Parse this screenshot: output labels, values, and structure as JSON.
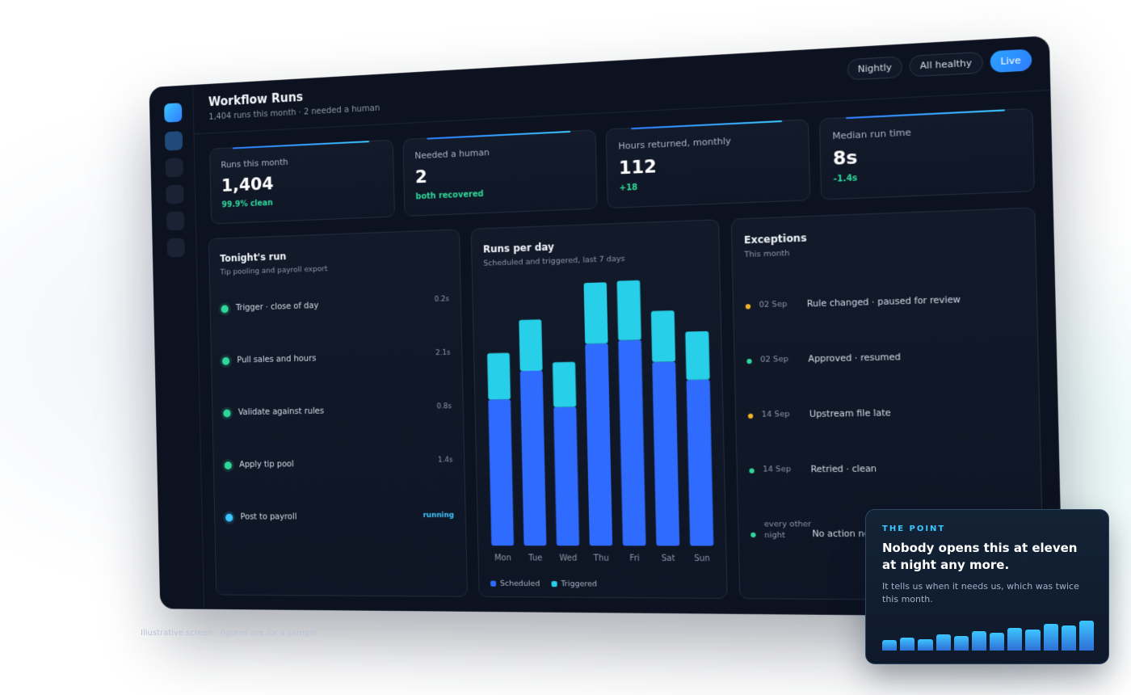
{
  "colors": {
    "scheduled": "#2f6bff",
    "triggered": "#27d0e8",
    "ok": "#2fd89a",
    "warn": "#f5b325",
    "running": "#3cc6ff"
  },
  "header": {
    "title": "Workflow Runs",
    "subtitle": "1,404 runs this month · 2 needed a human",
    "pills": [
      "Nightly",
      "All healthy",
      "Live"
    ]
  },
  "kpis": [
    {
      "label": "Runs this month",
      "value": "1,404",
      "delta": "99.9% clean"
    },
    {
      "label": "Needed a human",
      "value": "2",
      "delta": "both recovered"
    },
    {
      "label": "Hours returned, monthly",
      "value": "112",
      "delta": "+18"
    },
    {
      "label": "Median run time",
      "value": "8s",
      "delta": "-1.4s"
    }
  ],
  "tonight": {
    "title": "Tonight's run",
    "subtitle": "Tip pooling and payroll export",
    "steps": [
      {
        "label": "Trigger · close of day",
        "time": "0.2s",
        "status": "done"
      },
      {
        "label": "Pull sales and hours",
        "time": "2.1s",
        "status": "done"
      },
      {
        "label": "Validate against rules",
        "time": "0.8s",
        "status": "done"
      },
      {
        "label": "Apply tip pool",
        "time": "1.4s",
        "status": "done"
      },
      {
        "label": "Post to payroll",
        "time": "running",
        "status": "running"
      }
    ]
  },
  "runs_chart": {
    "title": "Runs per day",
    "subtitle": "Scheduled and triggered, last 7 days",
    "legend": [
      "Scheduled",
      "Triggered"
    ]
  },
  "chart_data": {
    "type": "bar",
    "stacked": true,
    "categories": [
      "Mon",
      "Tue",
      "Wed",
      "Thu",
      "Fri",
      "Sat",
      "Sun"
    ],
    "series": [
      {
        "name": "Scheduled",
        "values": [
          167,
          199,
          157,
          228,
          231,
          206,
          185
        ]
      },
      {
        "name": "Triggered",
        "values": [
          53,
          58,
          51,
          69,
          67,
          57,
          54
        ]
      }
    ],
    "ylim": [
      0,
      310
    ],
    "grid": false,
    "legend_position": "bottom-left"
  },
  "exceptions": {
    "title": "Exceptions",
    "subtitle": "This month",
    "rows": [
      {
        "date": "02 Sep",
        "text": "Rule changed · paused for review",
        "level": "warn"
      },
      {
        "date": "02 Sep",
        "text": "Approved · resumed",
        "level": "ok"
      },
      {
        "date": "14 Sep",
        "text": "Upstream file late",
        "level": "warn"
      },
      {
        "date": "14 Sep",
        "text": "Retried · clean",
        "level": "ok"
      },
      {
        "date": "every other night",
        "text": "No action needed",
        "level": "ok"
      }
    ]
  },
  "caption": "Illustrative screen · figures are for a sample",
  "point_card": {
    "eyebrow": "THE POINT",
    "headline": "Nobody opens this at eleven at night any more.",
    "body": "It tells us when it needs us, which was twice this month.",
    "spark": [
      0.32,
      0.4,
      0.36,
      0.5,
      0.46,
      0.6,
      0.56,
      0.7,
      0.64,
      0.82,
      0.78,
      0.92
    ]
  }
}
